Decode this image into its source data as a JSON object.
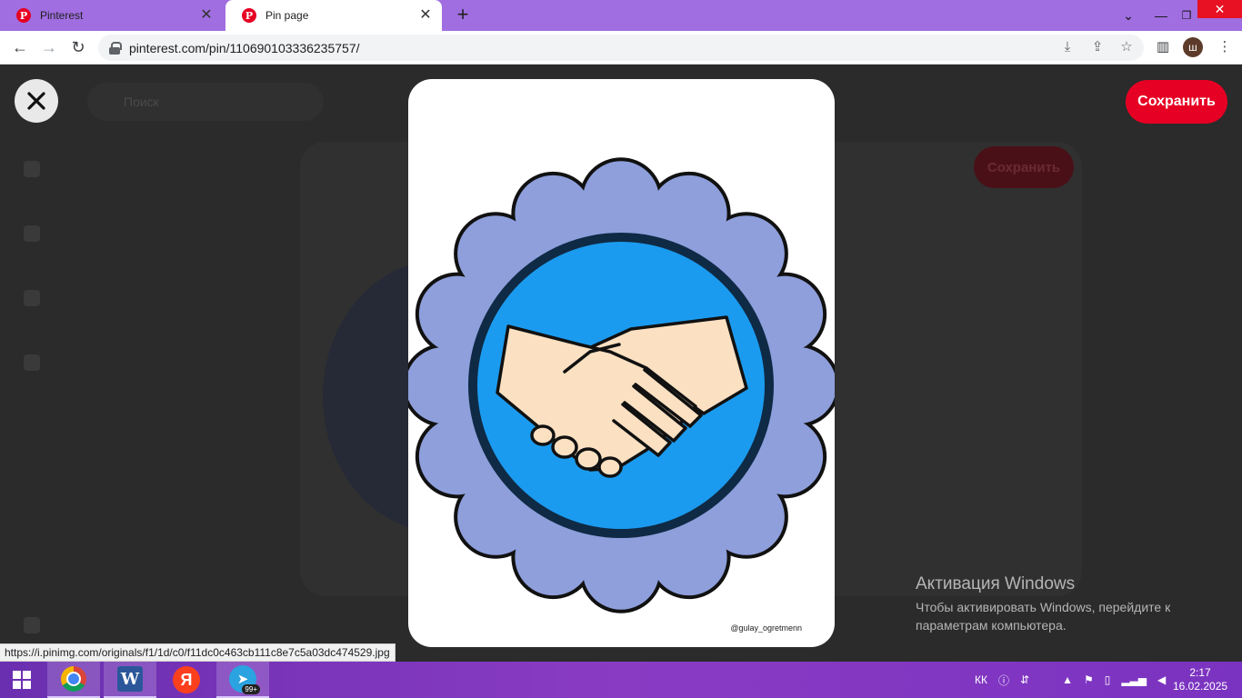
{
  "browser": {
    "tabs": [
      {
        "title": "Pinterest",
        "active": false
      },
      {
        "title": "Pin page",
        "active": true
      }
    ],
    "new_tab": "+",
    "url": "pinterest.com/pin/110690103336235757/",
    "profile_initial": "ш"
  },
  "page": {
    "background_search": "Поиск",
    "background_save": "Сохранить",
    "save_label": "Сохранить",
    "watermark": "@gulay_ogretmenn",
    "colors": {
      "save_red": "#e60023",
      "petal_blue": "#8e9fdc",
      "circle_blue": "#1b9bef",
      "skin": "#fbe0c2"
    }
  },
  "activation": {
    "title": "Активация Windows",
    "line1": "Чтобы активировать Windows, перейдите к",
    "line2": "параметрам компьютера."
  },
  "status_url": "https://i.pinimg.com/originals/f1/1d/c0/f11dc0c463cb111c8e7c5a03dc474529.jpg",
  "taskbar": {
    "apps": [
      "start",
      "chrome",
      "word",
      "yandex",
      "telegram"
    ],
    "telegram_badge": "99+",
    "language": "КК",
    "time": "2:17",
    "date": "16.02.2025"
  }
}
